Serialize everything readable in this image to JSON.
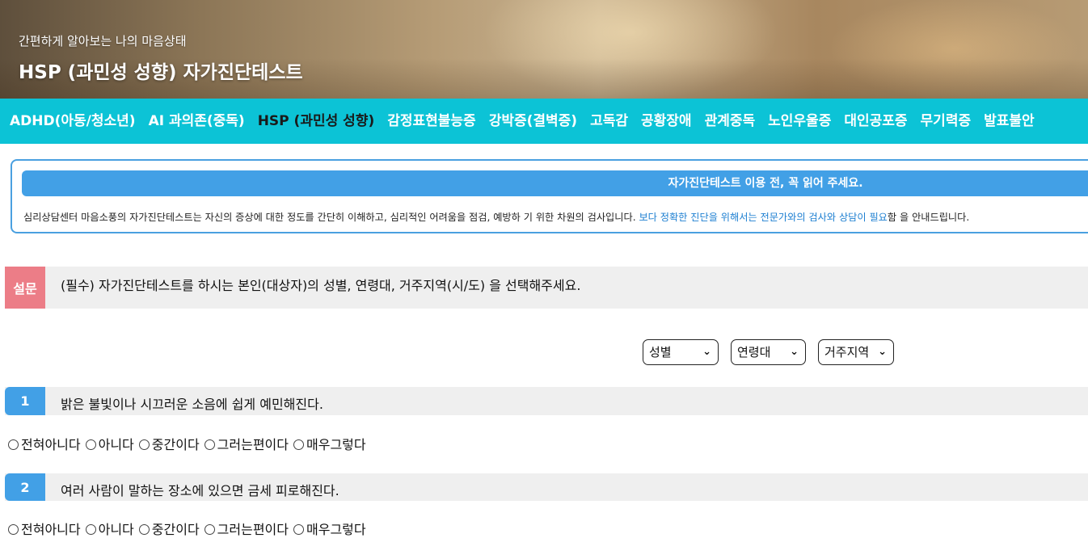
{
  "hero": {
    "subtitle": "간편하게 알아보는 나의 마음상태",
    "title": "HSP (과민성 성향) 자가진단테스트"
  },
  "nav": {
    "items": [
      "ADHD(아동/청소년)",
      "AI 과의존(중독)",
      "HSP (과민성 성향)",
      "감정표현불능증",
      "강박증(결벽증)",
      "고독감",
      "공황장애",
      "관계중독",
      "노인우울증",
      "대인공포증",
      "무기력증",
      "발표불안"
    ],
    "active_index": 2
  },
  "notice": {
    "heading": "자가진단테스트 이용 전, 꼭 읽어 주세요.",
    "text_before": "심리상담센터 마음소풍의 자가진단테스트는 자신의 증상에 대한 정도를 간단히 이해하고, 심리적인 어려움을 점검, 예방하 기 위한 차원의 검사입니다. ",
    "text_link": "보다 정확한 진단을 위해서는 전문가와의 검사와 상담이 필요",
    "text_after": "함 을 안내드립니다."
  },
  "survey": {
    "badge": "설문",
    "question": "(필수) 자가진단테스트를 하시는 본인(대상자)의 성별, 연령대, 거주지역(시/도) 을 선택해주세요.",
    "selects": {
      "gender": "성별",
      "age": "연령대",
      "region": "거주지역"
    }
  },
  "questions": [
    {
      "number": "1",
      "text": "밝은 불빛이나 시끄러운 소음에 쉽게 예민해진다."
    },
    {
      "number": "2",
      "text": "여러 사람이 말하는 장소에 있으면 금세 피로해진다."
    }
  ],
  "answer_options": [
    "전혀아니다",
    "아니다",
    "중간이다",
    "그러는편이다",
    "매우그렇다"
  ],
  "colors": {
    "nav_bg": "#0cc3d6",
    "accent_blue": "#42a0e6",
    "survey_badge": "#ec7d87",
    "link": "#1d7fd1"
  }
}
